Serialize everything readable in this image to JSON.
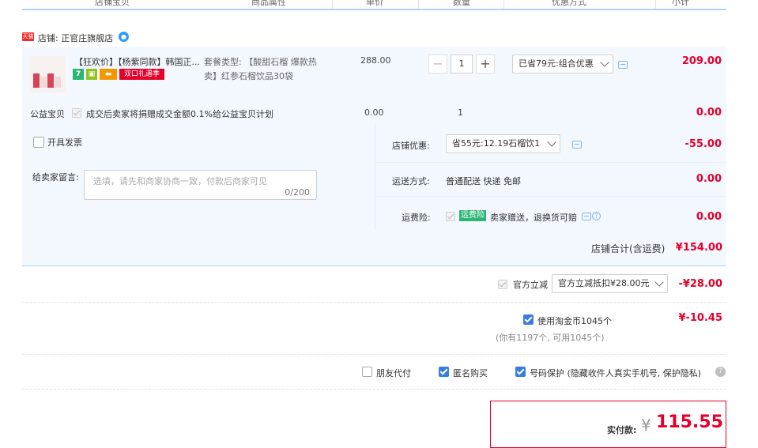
{
  "header": {
    "columns": [
      "店铺宝贝",
      "商品属性",
      "单价",
      "数量",
      "优惠方式",
      "小计"
    ]
  },
  "shop": {
    "tag": "天猫",
    "label": "店铺: 正官庄旗舰店"
  },
  "item": {
    "title": "【狂欢价】【杨紫同款】韩国正...",
    "badge_7": "7",
    "badge_double": "双口礼遇季",
    "attr": "套餐类型: 【酸甜石榴 爆款热卖】红参石榴饮品30袋",
    "price": "288.00",
    "quantity": "1",
    "qty_minus": "−",
    "qty_plus": "+",
    "discount": "已省79元:组合优惠",
    "subtotal": "209.00"
  },
  "charity": {
    "label": "公益宝贝",
    "text": "成交后卖家将捐赠成交金额0.1%给公益宝贝计划",
    "price": "0.00",
    "qty": "1",
    "subtotal": "0.00"
  },
  "invoice": {
    "label": "开具发票"
  },
  "message": {
    "label": "给卖家留言:",
    "placeholder": "选填，请先和商家协商一致，付款后商家可见",
    "counter": "0/200"
  },
  "shop_discount": {
    "label": "店铺优惠:",
    "value": "省55元:12.19石榴饮1",
    "amount": "-55.00"
  },
  "shipping": {
    "label": "运送方式:",
    "value": "普通配送 快递 免邮",
    "amount": "0.00"
  },
  "insurance": {
    "label": "运费险:",
    "tag": "运费险",
    "text": "卖家赠送，退换货可赔",
    "amount": "0.00"
  },
  "shop_total": {
    "label": "店铺合计(含运费)",
    "amount": "¥154.00"
  },
  "official": {
    "label": "官方立减",
    "value": "官方立减抵扣¥28.00元",
    "amount": "-¥28.00"
  },
  "coins": {
    "label": "使用淘金币1045个",
    "note": "(你有1197个, 可用1045个)",
    "amount": "¥-10.45"
  },
  "options": {
    "friend_pay": "朋友代付",
    "anonymous": "匿名购买",
    "privacy": "号码保护 (隐藏收件人真实手机号, 保护隐私)"
  },
  "payment": {
    "label": "实付款:",
    "currency": "¥",
    "amount": "115.55"
  },
  "colors": {
    "accent_red": "#e4002b",
    "accent_blue": "#3a7de0",
    "panel_bg": "#f3f8ff"
  }
}
